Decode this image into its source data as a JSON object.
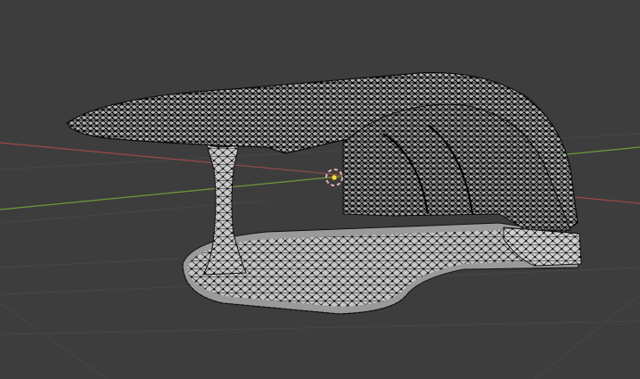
{
  "viewport": {
    "mode": "edit-mode-wireframe",
    "background_color": "#3d3d3d",
    "grid_color": "#484848",
    "x_axis_color": "#9a4a4a",
    "y_axis_color": "#6f9a3a",
    "mesh_face_color": "#bdbdbd",
    "mesh_edge_color": "#111111",
    "vertex_color": "#000000"
  },
  "object": {
    "icon": "3d-cursor-icon",
    "cursor_ring_color": "#e8b4b4",
    "cursor_center_color": "#f2d54a"
  }
}
